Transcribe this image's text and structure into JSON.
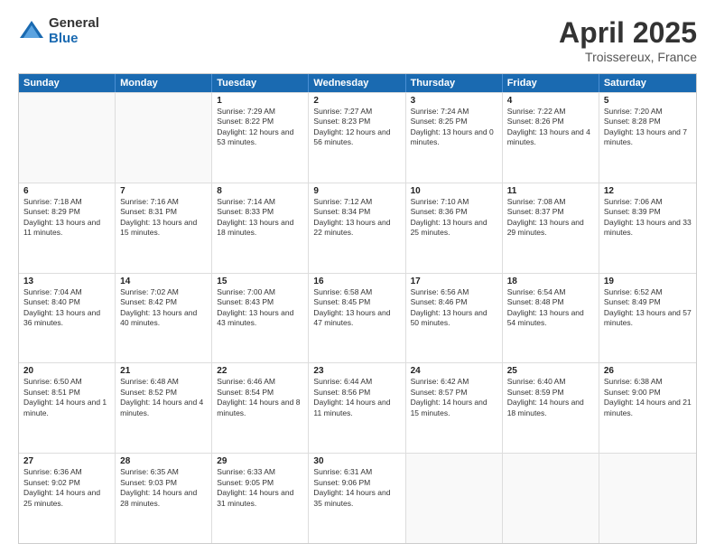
{
  "logo": {
    "general": "General",
    "blue": "Blue"
  },
  "title": {
    "month": "April 2025",
    "location": "Troissereux, France"
  },
  "header_days": [
    "Sunday",
    "Monday",
    "Tuesday",
    "Wednesday",
    "Thursday",
    "Friday",
    "Saturday"
  ],
  "weeks": [
    [
      {
        "day": "",
        "sunrise": "",
        "sunset": "",
        "daylight": ""
      },
      {
        "day": "",
        "sunrise": "",
        "sunset": "",
        "daylight": ""
      },
      {
        "day": "1",
        "sunrise": "Sunrise: 7:29 AM",
        "sunset": "Sunset: 8:22 PM",
        "daylight": "Daylight: 12 hours and 53 minutes."
      },
      {
        "day": "2",
        "sunrise": "Sunrise: 7:27 AM",
        "sunset": "Sunset: 8:23 PM",
        "daylight": "Daylight: 12 hours and 56 minutes."
      },
      {
        "day": "3",
        "sunrise": "Sunrise: 7:24 AM",
        "sunset": "Sunset: 8:25 PM",
        "daylight": "Daylight: 13 hours and 0 minutes."
      },
      {
        "day": "4",
        "sunrise": "Sunrise: 7:22 AM",
        "sunset": "Sunset: 8:26 PM",
        "daylight": "Daylight: 13 hours and 4 minutes."
      },
      {
        "day": "5",
        "sunrise": "Sunrise: 7:20 AM",
        "sunset": "Sunset: 8:28 PM",
        "daylight": "Daylight: 13 hours and 7 minutes."
      }
    ],
    [
      {
        "day": "6",
        "sunrise": "Sunrise: 7:18 AM",
        "sunset": "Sunset: 8:29 PM",
        "daylight": "Daylight: 13 hours and 11 minutes."
      },
      {
        "day": "7",
        "sunrise": "Sunrise: 7:16 AM",
        "sunset": "Sunset: 8:31 PM",
        "daylight": "Daylight: 13 hours and 15 minutes."
      },
      {
        "day": "8",
        "sunrise": "Sunrise: 7:14 AM",
        "sunset": "Sunset: 8:33 PM",
        "daylight": "Daylight: 13 hours and 18 minutes."
      },
      {
        "day": "9",
        "sunrise": "Sunrise: 7:12 AM",
        "sunset": "Sunset: 8:34 PM",
        "daylight": "Daylight: 13 hours and 22 minutes."
      },
      {
        "day": "10",
        "sunrise": "Sunrise: 7:10 AM",
        "sunset": "Sunset: 8:36 PM",
        "daylight": "Daylight: 13 hours and 25 minutes."
      },
      {
        "day": "11",
        "sunrise": "Sunrise: 7:08 AM",
        "sunset": "Sunset: 8:37 PM",
        "daylight": "Daylight: 13 hours and 29 minutes."
      },
      {
        "day": "12",
        "sunrise": "Sunrise: 7:06 AM",
        "sunset": "Sunset: 8:39 PM",
        "daylight": "Daylight: 13 hours and 33 minutes."
      }
    ],
    [
      {
        "day": "13",
        "sunrise": "Sunrise: 7:04 AM",
        "sunset": "Sunset: 8:40 PM",
        "daylight": "Daylight: 13 hours and 36 minutes."
      },
      {
        "day": "14",
        "sunrise": "Sunrise: 7:02 AM",
        "sunset": "Sunset: 8:42 PM",
        "daylight": "Daylight: 13 hours and 40 minutes."
      },
      {
        "day": "15",
        "sunrise": "Sunrise: 7:00 AM",
        "sunset": "Sunset: 8:43 PM",
        "daylight": "Daylight: 13 hours and 43 minutes."
      },
      {
        "day": "16",
        "sunrise": "Sunrise: 6:58 AM",
        "sunset": "Sunset: 8:45 PM",
        "daylight": "Daylight: 13 hours and 47 minutes."
      },
      {
        "day": "17",
        "sunrise": "Sunrise: 6:56 AM",
        "sunset": "Sunset: 8:46 PM",
        "daylight": "Daylight: 13 hours and 50 minutes."
      },
      {
        "day": "18",
        "sunrise": "Sunrise: 6:54 AM",
        "sunset": "Sunset: 8:48 PM",
        "daylight": "Daylight: 13 hours and 54 minutes."
      },
      {
        "day": "19",
        "sunrise": "Sunrise: 6:52 AM",
        "sunset": "Sunset: 8:49 PM",
        "daylight": "Daylight: 13 hours and 57 minutes."
      }
    ],
    [
      {
        "day": "20",
        "sunrise": "Sunrise: 6:50 AM",
        "sunset": "Sunset: 8:51 PM",
        "daylight": "Daylight: 14 hours and 1 minute."
      },
      {
        "day": "21",
        "sunrise": "Sunrise: 6:48 AM",
        "sunset": "Sunset: 8:52 PM",
        "daylight": "Daylight: 14 hours and 4 minutes."
      },
      {
        "day": "22",
        "sunrise": "Sunrise: 6:46 AM",
        "sunset": "Sunset: 8:54 PM",
        "daylight": "Daylight: 14 hours and 8 minutes."
      },
      {
        "day": "23",
        "sunrise": "Sunrise: 6:44 AM",
        "sunset": "Sunset: 8:56 PM",
        "daylight": "Daylight: 14 hours and 11 minutes."
      },
      {
        "day": "24",
        "sunrise": "Sunrise: 6:42 AM",
        "sunset": "Sunset: 8:57 PM",
        "daylight": "Daylight: 14 hours and 15 minutes."
      },
      {
        "day": "25",
        "sunrise": "Sunrise: 6:40 AM",
        "sunset": "Sunset: 8:59 PM",
        "daylight": "Daylight: 14 hours and 18 minutes."
      },
      {
        "day": "26",
        "sunrise": "Sunrise: 6:38 AM",
        "sunset": "Sunset: 9:00 PM",
        "daylight": "Daylight: 14 hours and 21 minutes."
      }
    ],
    [
      {
        "day": "27",
        "sunrise": "Sunrise: 6:36 AM",
        "sunset": "Sunset: 9:02 PM",
        "daylight": "Daylight: 14 hours and 25 minutes."
      },
      {
        "day": "28",
        "sunrise": "Sunrise: 6:35 AM",
        "sunset": "Sunset: 9:03 PM",
        "daylight": "Daylight: 14 hours and 28 minutes."
      },
      {
        "day": "29",
        "sunrise": "Sunrise: 6:33 AM",
        "sunset": "Sunset: 9:05 PM",
        "daylight": "Daylight: 14 hours and 31 minutes."
      },
      {
        "day": "30",
        "sunrise": "Sunrise: 6:31 AM",
        "sunset": "Sunset: 9:06 PM",
        "daylight": "Daylight: 14 hours and 35 minutes."
      },
      {
        "day": "",
        "sunrise": "",
        "sunset": "",
        "daylight": ""
      },
      {
        "day": "",
        "sunrise": "",
        "sunset": "",
        "daylight": ""
      },
      {
        "day": "",
        "sunrise": "",
        "sunset": "",
        "daylight": ""
      }
    ]
  ]
}
